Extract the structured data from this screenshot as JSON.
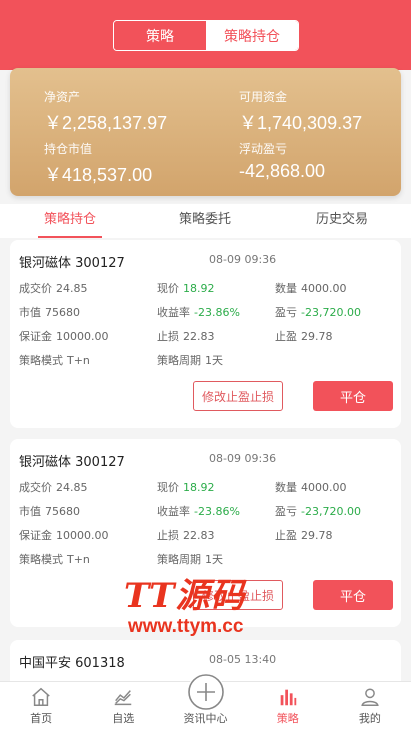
{
  "header": {
    "tabs": [
      {
        "label": "策略",
        "active": true
      },
      {
        "label": "策略持仓",
        "active": false
      }
    ]
  },
  "assets": {
    "net_label": "净资产",
    "net_value": "￥2,258,137.97",
    "avail_label": "可用资金",
    "avail_value": "￥1,740,309.37",
    "mv_label": "持仓市值",
    "mv_value": "￥418,537.00",
    "pl_label": "浮动盈亏",
    "pl_value": "-42,868.00"
  },
  "tabs": [
    "策略持仓",
    "策略委托",
    "历史交易"
  ],
  "labels": {
    "price": "成交价",
    "cur": "现价",
    "qty": "数量",
    "mv": "市值",
    "rate": "收益率",
    "pl": "盈亏",
    "margin": "保证金",
    "stop_loss": "止损",
    "take_profit": "止盈",
    "mode": "策略模式",
    "period": "策略周期",
    "modify": "修改止盈止损",
    "close": "平仓"
  },
  "positions": [
    {
      "name": "银河磁体 300127",
      "time": "08-09 09:36",
      "price": "24.85",
      "cur": "18.92",
      "qty": "4000.00",
      "mv": "75680",
      "rate": "-23.86%",
      "pl": "-23,720.00",
      "margin": "10000.00",
      "stop_loss": "22.83",
      "take_profit": "29.78",
      "mode": "T+n",
      "period": "1天"
    },
    {
      "name": "银河磁体 300127",
      "time": "08-09 09:36",
      "price": "24.85",
      "cur": "18.92",
      "qty": "4000.00",
      "mv": "75680",
      "rate": "-23.86%",
      "pl": "-23,720.00",
      "margin": "10000.00",
      "stop_loss": "22.83",
      "take_profit": "29.78",
      "mode": "T+n",
      "period": "1天"
    },
    {
      "name": "中国平安 601318",
      "time": "08-05 13:40"
    }
  ],
  "watermark": {
    "line1": "TT源码",
    "line2": "www.ttym.cc"
  },
  "nav": [
    {
      "label": "首页",
      "icon": "home-icon"
    },
    {
      "label": "自选",
      "icon": "chart-line-icon"
    },
    {
      "label": "资讯中心",
      "icon": "plus-circle-icon"
    },
    {
      "label": "策略",
      "icon": "bar-chart-icon"
    },
    {
      "label": "我的",
      "icon": "user-icon"
    }
  ],
  "colors": {
    "brand": "#f2525a",
    "gold_start": "#e3c08e",
    "gold_end": "#d2a46c",
    "positive": "#2cac4a"
  }
}
